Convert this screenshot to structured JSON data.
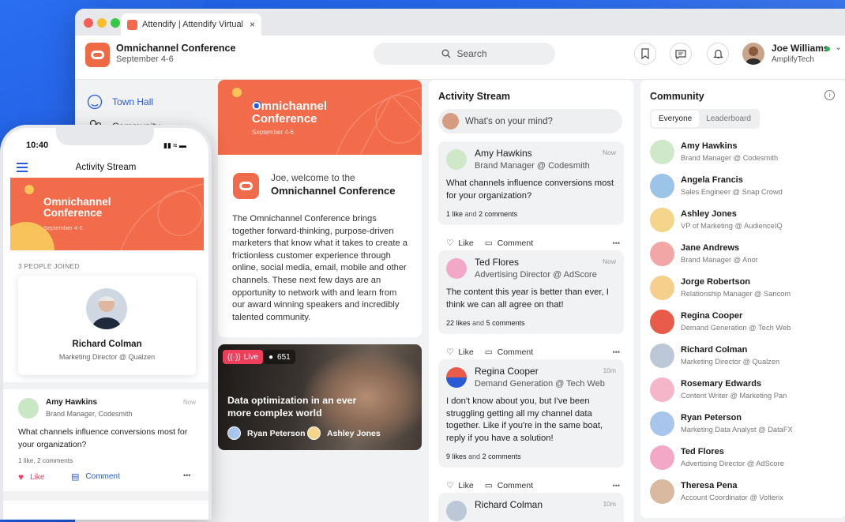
{
  "browser": {
    "tab_title": "Attendify | Attendify Virtual E",
    "tab_close": "×",
    "traffic_lights": [
      "#f25f58",
      "#f9be2e",
      "#37c84a"
    ]
  },
  "header": {
    "conference_title": "Omnichannel Conference",
    "conference_date": "September 4-6",
    "search_placeholder": "Search",
    "user_name": "Joe Williams",
    "user_company": "AmplifyTech",
    "chevron": "⌄"
  },
  "nav": {
    "items": [
      {
        "label": "Town Hall",
        "icon": "home-icon",
        "active": true
      },
      {
        "label": "Community",
        "icon": "people-icon",
        "active": false
      }
    ]
  },
  "welcome": {
    "banner_title_line1": "Omnichannel",
    "banner_title_line2": "Conference",
    "banner_date": "September 4-6",
    "greeting": "Joe, welcome to the",
    "conference_name": "Omnichannel Conference",
    "body": "The Omnichannel Conference brings together forward-thinking, purpose-driven marketers that know what it takes to create a frictionless customer experience through online, social media, email, mobile and other channels. These next few days are an opportunity to network with and learn from our award winning speakers and incredibly talented community."
  },
  "live_session": {
    "badge": "Live",
    "viewers": "651",
    "title": "Data optimization in an ever more complex world",
    "speakers": [
      "Ryan Peterson",
      "Ashley Jones"
    ]
  },
  "activity": {
    "title": "Activity Stream",
    "compose_placeholder": "What's on your mind?",
    "like_label": "Like",
    "comment_label": "Comment",
    "more": "•••",
    "posts": [
      {
        "name": "Amy Hawkins",
        "role": "Brand Manager @ Codesmith",
        "time": "Now",
        "body": "What channels influence conversions most for your organization?",
        "likes": "1 like",
        "comments": "2 comments"
      },
      {
        "name": "Ted Flores",
        "role": "Advertising Director @ AdScore",
        "time": "Now",
        "body": "The content this year is better than ever, I think we can all agree on that!",
        "likes": "22 likes",
        "comments": "5 comments"
      },
      {
        "name": "Regina Cooper",
        "role": "Demand Generation @ Tech Web",
        "time": "10m",
        "body": "I don't know about you, but I've been struggling getting all my channel data together. Like if you're in the same boat, reply if you have a solution!",
        "likes": "9 likes",
        "comments": "2 comments"
      },
      {
        "name": "Richard Colman",
        "role": "",
        "time": "10m",
        "body": "",
        "likes": "",
        "comments": ""
      }
    ],
    "and_word": "and"
  },
  "community": {
    "title": "Community",
    "tabs": [
      "Everyone",
      "Leaderboard"
    ],
    "members": [
      {
        "name": "Amy Hawkins",
        "role": "Brand Manager @ Codesmith",
        "color": "#cfe8c8"
      },
      {
        "name": "Angela Francis",
        "role": "Sales Engineer @ Snap Crowd",
        "color": "#9cc3e8"
      },
      {
        "name": "Ashley Jones",
        "role": "VP of Marketing @ AudienceIQ",
        "color": "#f5d48b"
      },
      {
        "name": "Jane Andrews",
        "role": "Brand Manager @ Anor",
        "color": "#f2a6a6"
      },
      {
        "name": "Jorge Robertson",
        "role": "Relationship Manager @ Sancom",
        "color": "#f7cf8c"
      },
      {
        "name": "Regina Cooper",
        "role": "Demand Generation @ Tech Web",
        "color": "#e85b4a"
      },
      {
        "name": "Richard Colman",
        "role": "Marketing Director @ Qualzen",
        "color": "#bcc8d8"
      },
      {
        "name": "Rosemary Edwards",
        "role": "Content Writer @ Marketing Pan",
        "color": "#f4b6c8"
      },
      {
        "name": "Ryan Peterson",
        "role": "Marketing Data Analyst @ DataFX",
        "color": "#a8c6ec"
      },
      {
        "name": "Ted Flores",
        "role": "Advertising Director @ AdScore",
        "color": "#f3a8c8"
      },
      {
        "name": "Theresa Pena",
        "role": "Account Coordinator @ Volterix",
        "color": "#d9b9a0"
      }
    ]
  },
  "phone": {
    "time": "10:40",
    "status_icons": "▮▮ ≈ ▬",
    "title": "Activity Stream",
    "banner_title_line1": "Omnichannel",
    "banner_title_line2": "Conference",
    "banner_date": "September 4-6",
    "joined_label": "3 PEOPLE JOINED",
    "joined_name": "Richard Colman",
    "joined_role": "Marketing Director @ Qualzen",
    "post_name": "Amy Hawkins",
    "post_role": "Brand Manager, Codesmith",
    "post_time": "Now",
    "post_body": "What channels influence conversions most for your organization?",
    "post_counts": "1 like,  2 comments",
    "like_label": "Like",
    "comment_label": "Comment",
    "more": "•••"
  }
}
